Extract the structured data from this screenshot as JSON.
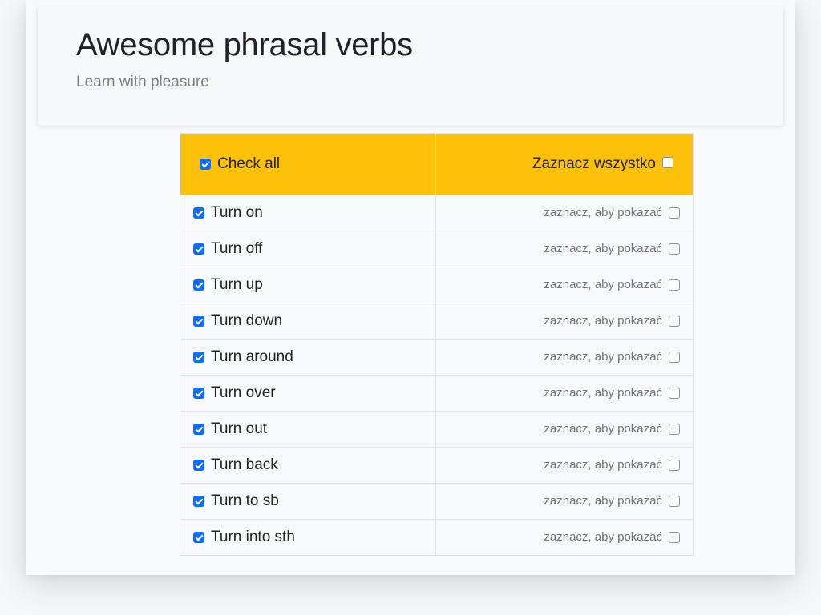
{
  "header": {
    "title": "Awesome phrasal verbs",
    "subtitle": "Learn with pleasure"
  },
  "table": {
    "check_all_label": "Check all",
    "check_all_checked": true,
    "zaznacz_label": "Zaznacz wszystko",
    "zaznacz_checked": false,
    "rows": [
      {
        "verb": "Turn on",
        "hint": "zaznacz, aby pokazać",
        "verb_checked": true,
        "show_checked": false
      },
      {
        "verb": "Turn off",
        "hint": "zaznacz, aby pokazać",
        "verb_checked": true,
        "show_checked": false
      },
      {
        "verb": "Turn up",
        "hint": "zaznacz, aby pokazać",
        "verb_checked": true,
        "show_checked": false
      },
      {
        "verb": "Turn down",
        "hint": "zaznacz, aby pokazać",
        "verb_checked": true,
        "show_checked": false
      },
      {
        "verb": "Turn around",
        "hint": "zaznacz, aby pokazać",
        "verb_checked": true,
        "show_checked": false
      },
      {
        "verb": "Turn over",
        "hint": "zaznacz, aby pokazać",
        "verb_checked": true,
        "show_checked": false
      },
      {
        "verb": "Turn out",
        "hint": "zaznacz, aby pokazać",
        "verb_checked": true,
        "show_checked": false
      },
      {
        "verb": "Turn back",
        "hint": "zaznacz, aby pokazać",
        "verb_checked": true,
        "show_checked": false
      },
      {
        "verb": "Turn to sb",
        "hint": "zaznacz, aby pokazać",
        "verb_checked": true,
        "show_checked": false
      },
      {
        "verb": "Turn into sth",
        "hint": "zaznacz, aby pokazać",
        "verb_checked": true,
        "show_checked": false
      }
    ]
  },
  "colors": {
    "header_accent": "#fdc10a",
    "checkbox_checked": "#0d6efd"
  }
}
